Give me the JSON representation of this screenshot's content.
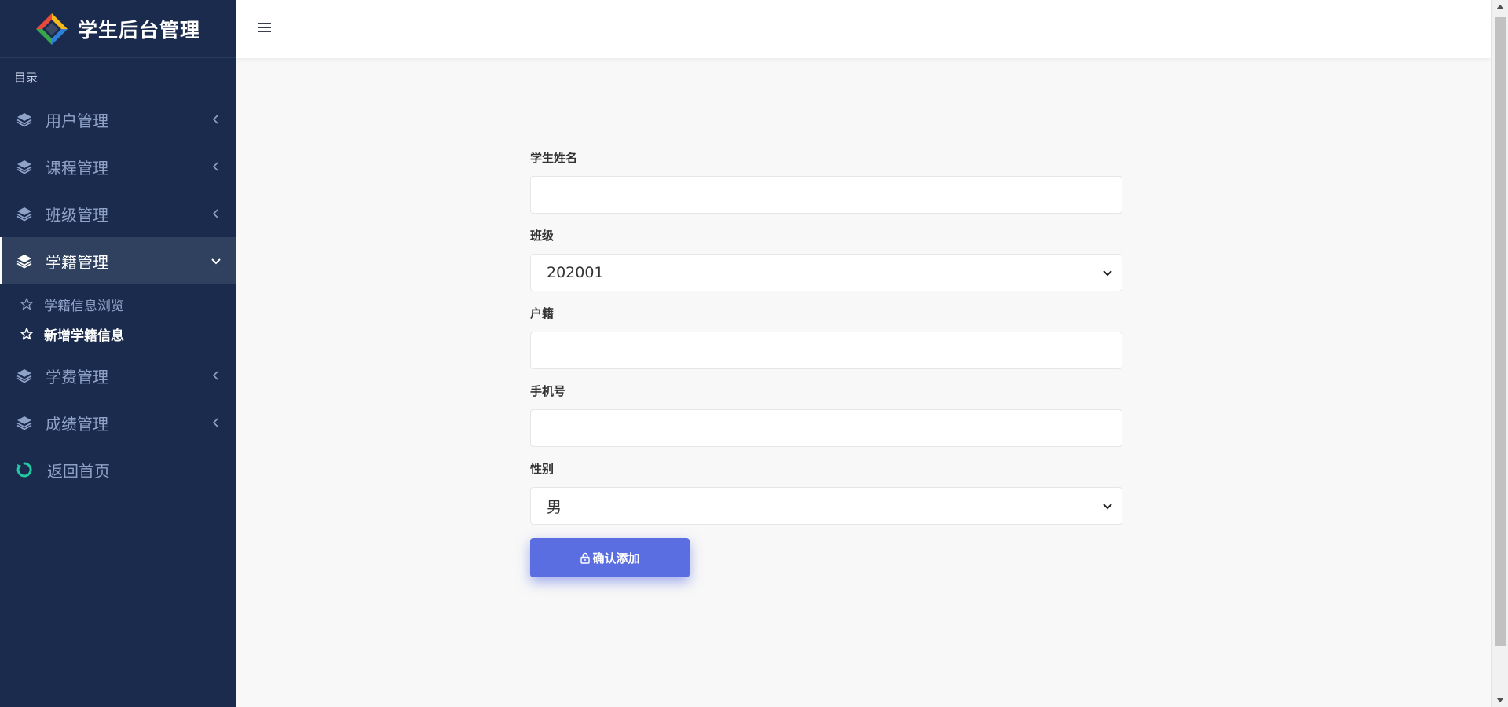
{
  "brand": {
    "title": "学生后台管理"
  },
  "sidebar": {
    "section_label": "目录",
    "items": [
      {
        "label": "用户管理",
        "icon": "layers-icon"
      },
      {
        "label": "课程管理",
        "icon": "layers-icon"
      },
      {
        "label": "班级管理",
        "icon": "layers-icon"
      },
      {
        "label": "学籍管理",
        "icon": "layers-icon",
        "active": true,
        "children": [
          {
            "label": "学籍信息浏览",
            "icon": "star-outline-icon"
          },
          {
            "label": "新增学籍信息",
            "icon": "star-outline-icon",
            "active": true
          }
        ]
      },
      {
        "label": "学费管理",
        "icon": "layers-icon"
      },
      {
        "label": "成绩管理",
        "icon": "layers-icon"
      }
    ],
    "home": {
      "label": "返回首页",
      "icon": "refresh-circle-icon"
    }
  },
  "form": {
    "student_name": {
      "label": "学生姓名",
      "value": ""
    },
    "class": {
      "label": "班级",
      "value": "202001"
    },
    "household": {
      "label": "户籍",
      "value": ""
    },
    "phone": {
      "label": "手机号",
      "value": ""
    },
    "gender": {
      "label": "性别",
      "value": "男"
    },
    "submit_label": "确认添加"
  },
  "colors": {
    "sidebar_bg": "#1a2b4d",
    "sidebar_active_bg": "#2f415e",
    "accent_button": "#5b6ee1",
    "home_icon": "#22c9a2",
    "page_bg": "#f8f8f8"
  }
}
